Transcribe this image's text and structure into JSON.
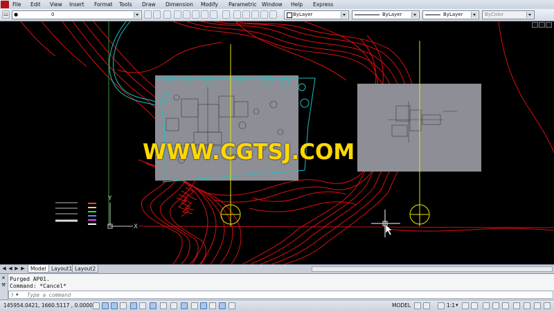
{
  "menu": {
    "items": [
      "File",
      "Edit",
      "View",
      "Insert",
      "Format",
      "Tools",
      "Draw",
      "Dimension",
      "Modify",
      "Parametric",
      "Window",
      "Help",
      "Express"
    ]
  },
  "toolbar": {
    "layer_value": "0",
    "color_value": "ByLayer",
    "linetype_value": "ByLayer",
    "lineweight_value": "ByLayer",
    "plotstyle_value": "ByColor"
  },
  "canvas": {
    "watermark_text": "WWW.CGTSJ.COM",
    "ucs_x_label": "X",
    "ucs_y_label": "Y",
    "colors": {
      "contour": "#e01010",
      "boundary": "#20c0c0",
      "gridline": "#e8e800",
      "axis_green": "#2f9a2f",
      "floorplan_fill": "#8e8e96",
      "watermark": "#ffd800"
    }
  },
  "tabs": {
    "items": [
      "Model",
      "Layout1",
      "Layout2"
    ],
    "active": "Model"
  },
  "command": {
    "history": [
      "Purged AP01.",
      "Command: *Cancel*"
    ],
    "placeholder": "Type a command"
  },
  "status": {
    "coordinates": "145954.0421, 1660.5117 , 0.0000",
    "model_label": "MODEL",
    "scale_label": "1:1"
  }
}
